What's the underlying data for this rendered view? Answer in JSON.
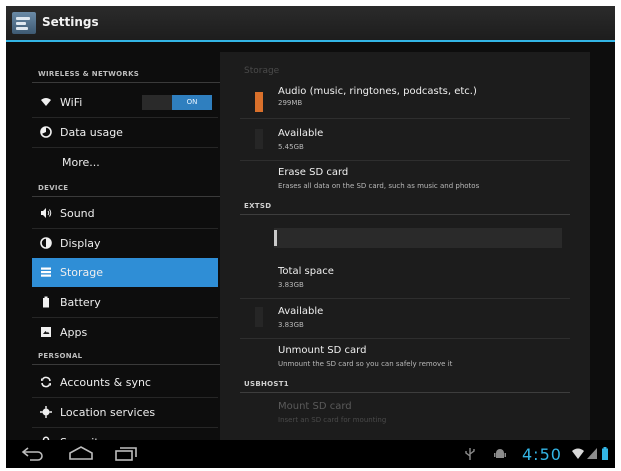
{
  "window": {
    "title": "Settings"
  },
  "menu": {
    "sections": {
      "wireless": "WIRELESS & NETWORKS",
      "device": "DEVICE",
      "personal": "PERSONAL"
    },
    "wifi": {
      "label": "WiFi",
      "toggle": "ON"
    },
    "data_usage": "Data usage",
    "more": "More...",
    "sound": "Sound",
    "display": "Display",
    "storage": "Storage",
    "battery": "Battery",
    "apps": "Apps",
    "accounts": "Accounts & sync",
    "location": "Location services",
    "security": "Security"
  },
  "pane": {
    "header": "Storage",
    "audio": {
      "title": "Audio (music, ringtones, podcasts, etc.)",
      "size": "299MB",
      "color": "#d9702b"
    },
    "available1": {
      "title": "Available",
      "size": "5.45GB"
    },
    "erase": {
      "title": "Erase SD card",
      "desc": "Erases all data on the SD card, such as music and photos"
    },
    "extsd_header": "EXTSD",
    "extsd_used_fraction": 0.01,
    "total": {
      "title": "Total space",
      "size": "3.83GB"
    },
    "available2": {
      "title": "Available",
      "size": "3.83GB"
    },
    "unmount": {
      "title": "Unmount SD card",
      "desc": "Unmount the SD card so you can safely remove it"
    },
    "usbhost_header": "USBHOST1",
    "mount": {
      "title": "Mount SD card",
      "desc": "Insert an SD card for mounting"
    }
  },
  "statusbar": {
    "time": "4:50"
  },
  "colors": {
    "accent": "#33b5e5",
    "selected": "#2f8ed6"
  }
}
